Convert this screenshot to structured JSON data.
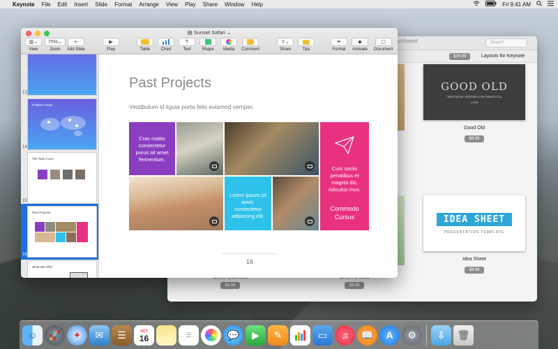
{
  "menubar": {
    "apple": "",
    "app": "Keynote",
    "menus": [
      "File",
      "Edit",
      "Insert",
      "Slide",
      "Format",
      "Arrange",
      "View",
      "Play",
      "Share",
      "Window",
      "Help"
    ],
    "clock": "Fri 9:41 AM"
  },
  "theme_window": {
    "purchased_tab": "Purchased",
    "search_placeholder": "Search",
    "bundle_price": "$29.99",
    "bundle_name": "Layouts for Keynote",
    "themes": [
      {
        "name": "Good Old",
        "price": "$9.99",
        "title": "GOOD OLD",
        "tagline": "TRISTIQUE VESTIBULUM VEHICULA",
        "year": "2014"
      },
      {
        "name": "Idea Sheet",
        "price": "$9.99",
        "title": "IDEA SHEET",
        "tagline": "PRESENTATION TEMPLATE"
      }
    ],
    "partial_themes": [
      {
        "name": "Green Business",
        "price": "$9.99"
      },
      {
        "name": "Green Shoots",
        "price": "$9.99"
      }
    ]
  },
  "window": {
    "title": "Sunset Safari",
    "toolbar": [
      {
        "id": "view",
        "label": "View",
        "icon": "sidebar-icon"
      },
      {
        "id": "zoom",
        "label": "Zoom",
        "value": "75%"
      },
      {
        "id": "add-slide",
        "label": "Add Slide",
        "icon": "plus-icon"
      },
      {
        "id": "play",
        "label": "Play",
        "icon": "play-icon"
      },
      {
        "id": "table",
        "label": "Table",
        "icon": "table-icon"
      },
      {
        "id": "chart",
        "label": "Chart",
        "icon": "chart-icon"
      },
      {
        "id": "text",
        "label": "Text",
        "icon": "text-icon"
      },
      {
        "id": "shape",
        "label": "Shape",
        "icon": "shape-icon"
      },
      {
        "id": "media",
        "label": "Media",
        "icon": "media-icon"
      },
      {
        "id": "comment",
        "label": "Comment",
        "icon": "comment-icon"
      },
      {
        "id": "share",
        "label": "Share",
        "icon": "share-icon"
      },
      {
        "id": "tips",
        "label": "Tips",
        "icon": "tips-icon"
      },
      {
        "id": "format",
        "label": "Format",
        "icon": "format-icon"
      },
      {
        "id": "animate",
        "label": "Animate",
        "icon": "animate-icon"
      },
      {
        "id": "document",
        "label": "Document",
        "icon": "document-icon"
      }
    ]
  },
  "navigator": {
    "slides": [
      {
        "num": "13",
        "title": ""
      },
      {
        "num": "14",
        "title": "Problem Areas"
      },
      {
        "num": "15",
        "title": "The Task Force"
      },
      {
        "num": "16",
        "title": "Past Projects",
        "selected": true
      },
      {
        "num": "17",
        "title": "What We Offer"
      }
    ]
  },
  "slide": {
    "title": "Past Projects",
    "subtitle": "Vestibulum id ligula porta felis euismod semper.",
    "tile_purple": "Cras mattis consectetur purus sit amet fermentum.",
    "tile_cyan": "Lorem ipsum sit amet, consectetur adipiscing elit.",
    "tile_pink": "Cum sociis penatibus et magnis dis, ridiculus mus.",
    "tile_pink_heading": "Commodo Cursus",
    "page_number": "16"
  },
  "dock": {
    "apps": [
      "Finder",
      "Launchpad",
      "Safari",
      "Mail",
      "Contacts",
      "Calendar",
      "Notes",
      "Reminders",
      "Photos",
      "Messages",
      "FaceTime",
      "Pages",
      "Numbers",
      "Keynote",
      "iTunes",
      "iBooks",
      "App Store",
      "System Preferences",
      "Downloads",
      "Trash"
    ],
    "calendar_month": "OCT",
    "calendar_day": "16"
  }
}
